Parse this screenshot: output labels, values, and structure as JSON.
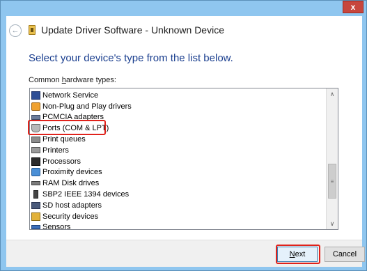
{
  "titlebar": {
    "close_label": "x"
  },
  "header": {
    "back_glyph": "←",
    "title": "Update Driver Software - Unknown Device"
  },
  "instruction": "Select your device's type from the list below.",
  "list": {
    "caption_prefix": "Common ",
    "caption_mnemonic": "h",
    "caption_suffix": "ardware types:",
    "items": [
      {
        "label": "Network Service",
        "icon": "network-service-icon"
      },
      {
        "label": "Non-Plug and Play drivers",
        "icon": "non-pnp-driver-icon"
      },
      {
        "label": "PCMCIA adapters",
        "icon": "pcmcia-adapter-icon"
      },
      {
        "label": "Ports (COM & LPT)",
        "icon": "port-connector-icon"
      },
      {
        "label": "Print queues",
        "icon": "print-queue-icon"
      },
      {
        "label": "Printers",
        "icon": "printer-icon"
      },
      {
        "label": "Processors",
        "icon": "processor-icon"
      },
      {
        "label": "Proximity devices",
        "icon": "proximity-device-icon"
      },
      {
        "label": "RAM Disk drives",
        "icon": "ram-disk-icon"
      },
      {
        "label": "SBP2 IEEE 1394 devices",
        "icon": "sbp2-device-icon"
      },
      {
        "label": "SD host adapters",
        "icon": "sd-host-adapter-icon"
      },
      {
        "label": "Security devices",
        "icon": "security-device-icon"
      },
      {
        "label": "Sensors",
        "icon": "sensor-icon"
      }
    ],
    "scroll_up_glyph": "∧",
    "scroll_down_glyph": "∨",
    "scroll_thumb_glyph": "≡"
  },
  "footer": {
    "next_mnemonic": "N",
    "next_rest": "ext",
    "cancel_label": "Cancel"
  },
  "colors": {
    "highlight": "#e0221b",
    "instruction": "#1b3f8f",
    "frame": "#8fc6ef"
  }
}
